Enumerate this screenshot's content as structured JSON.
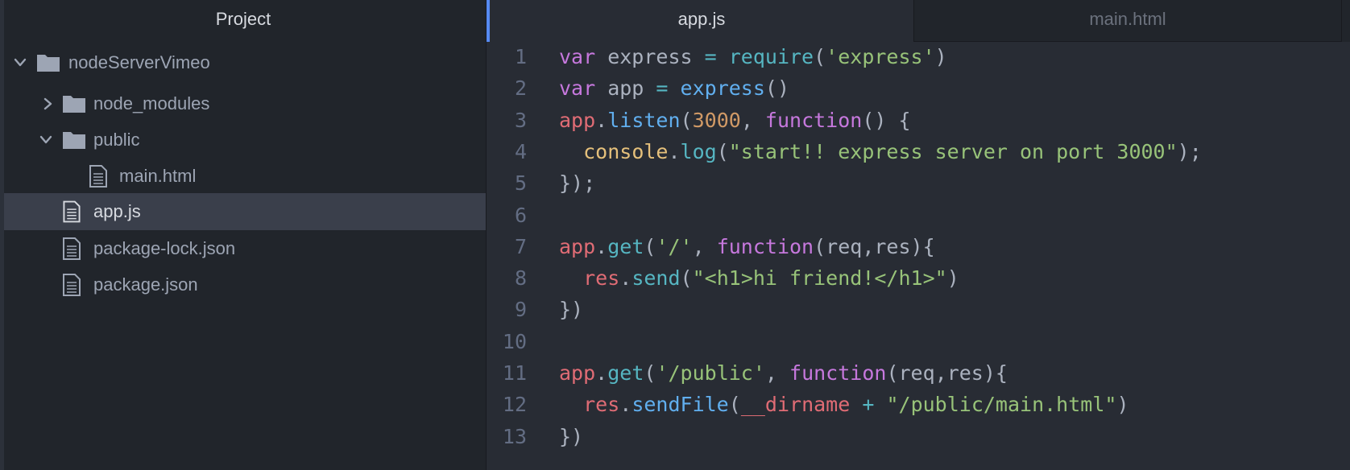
{
  "tree": {
    "title": "Project",
    "items": [
      {
        "label": "nodeServerVimeo",
        "type": "folder",
        "expanded": true,
        "depth": 0,
        "selected": false
      },
      {
        "label": "node_modules",
        "type": "folder",
        "expanded": false,
        "depth": 1,
        "selected": false
      },
      {
        "label": "public",
        "type": "folder",
        "expanded": true,
        "depth": 1,
        "selected": false
      },
      {
        "label": "main.html",
        "type": "file",
        "depth": 2,
        "selected": false
      },
      {
        "label": "app.js",
        "type": "file",
        "depth": 1,
        "selected": true
      },
      {
        "label": "package-lock.json",
        "type": "file",
        "depth": 1,
        "selected": false
      },
      {
        "label": "package.json",
        "type": "file",
        "depth": 1,
        "selected": false
      }
    ]
  },
  "tabs": [
    {
      "label": "app.js",
      "active": true
    },
    {
      "label": "main.html",
      "active": false
    }
  ],
  "editor": {
    "lines": [
      {
        "n": "1",
        "tokens": [
          [
            "var",
            "kw"
          ],
          [
            " express ",
            "plain"
          ],
          [
            "=",
            "op"
          ],
          [
            " ",
            "plain"
          ],
          [
            "require",
            "method"
          ],
          [
            "(",
            "plain"
          ],
          [
            "'express'",
            "str"
          ],
          [
            ")",
            "plain"
          ]
        ]
      },
      {
        "n": "2",
        "tokens": [
          [
            "var",
            "kw"
          ],
          [
            " app ",
            "plain"
          ],
          [
            "=",
            "op"
          ],
          [
            " ",
            "plain"
          ],
          [
            "express",
            "fn"
          ],
          [
            "()",
            "plain"
          ]
        ]
      },
      {
        "n": "3",
        "tokens": [
          [
            "app",
            "var"
          ],
          [
            ".",
            "plain"
          ],
          [
            "listen",
            "fn"
          ],
          [
            "(",
            "plain"
          ],
          [
            "3000",
            "num"
          ],
          [
            ", ",
            "plain"
          ],
          [
            "function",
            "kw"
          ],
          [
            "() {",
            "plain"
          ]
        ]
      },
      {
        "n": "4",
        "tokens": [
          [
            "  ",
            "plain"
          ],
          [
            "console",
            "obj"
          ],
          [
            ".",
            "plain"
          ],
          [
            "log",
            "method"
          ],
          [
            "(",
            "plain"
          ],
          [
            "\"start!! express server on port 3000\"",
            "str"
          ],
          [
            ");",
            "plain"
          ]
        ]
      },
      {
        "n": "5",
        "tokens": [
          [
            "});",
            "plain"
          ]
        ]
      },
      {
        "n": "6",
        "tokens": []
      },
      {
        "n": "7",
        "tokens": [
          [
            "app",
            "var"
          ],
          [
            ".",
            "plain"
          ],
          [
            "get",
            "method"
          ],
          [
            "(",
            "plain"
          ],
          [
            "'/'",
            "str"
          ],
          [
            ", ",
            "plain"
          ],
          [
            "function",
            "kw"
          ],
          [
            "(req,res){",
            "plain"
          ]
        ]
      },
      {
        "n": "8",
        "tokens": [
          [
            "  ",
            "plain"
          ],
          [
            "res",
            "var"
          ],
          [
            ".",
            "plain"
          ],
          [
            "send",
            "method"
          ],
          [
            "(",
            "plain"
          ],
          [
            "\"<h1>hi friend!</h1>\"",
            "str"
          ],
          [
            ")",
            "plain"
          ]
        ]
      },
      {
        "n": "9",
        "tokens": [
          [
            "})",
            "plain"
          ]
        ]
      },
      {
        "n": "10",
        "tokens": []
      },
      {
        "n": "11",
        "tokens": [
          [
            "app",
            "var"
          ],
          [
            ".",
            "plain"
          ],
          [
            "get",
            "method"
          ],
          [
            "(",
            "plain"
          ],
          [
            "'/public'",
            "str"
          ],
          [
            ", ",
            "plain"
          ],
          [
            "function",
            "kw"
          ],
          [
            "(req,res){",
            "plain"
          ]
        ]
      },
      {
        "n": "12",
        "tokens": [
          [
            "  ",
            "plain"
          ],
          [
            "res",
            "var"
          ],
          [
            ".",
            "plain"
          ],
          [
            "sendFile",
            "fn"
          ],
          [
            "(",
            "plain"
          ],
          [
            "__dirname",
            "var"
          ],
          [
            " ",
            "plain"
          ],
          [
            "+",
            "op"
          ],
          [
            " ",
            "plain"
          ],
          [
            "\"/public/main.html\"",
            "str"
          ],
          [
            ")",
            "plain"
          ]
        ]
      },
      {
        "n": "13",
        "tokens": [
          [
            "})",
            "plain"
          ]
        ]
      }
    ]
  },
  "colors": {
    "accent": "#568af2",
    "selection": "#3a3f4b",
    "panel_bg": "#21252b",
    "editor_bg": "#282c34"
  }
}
